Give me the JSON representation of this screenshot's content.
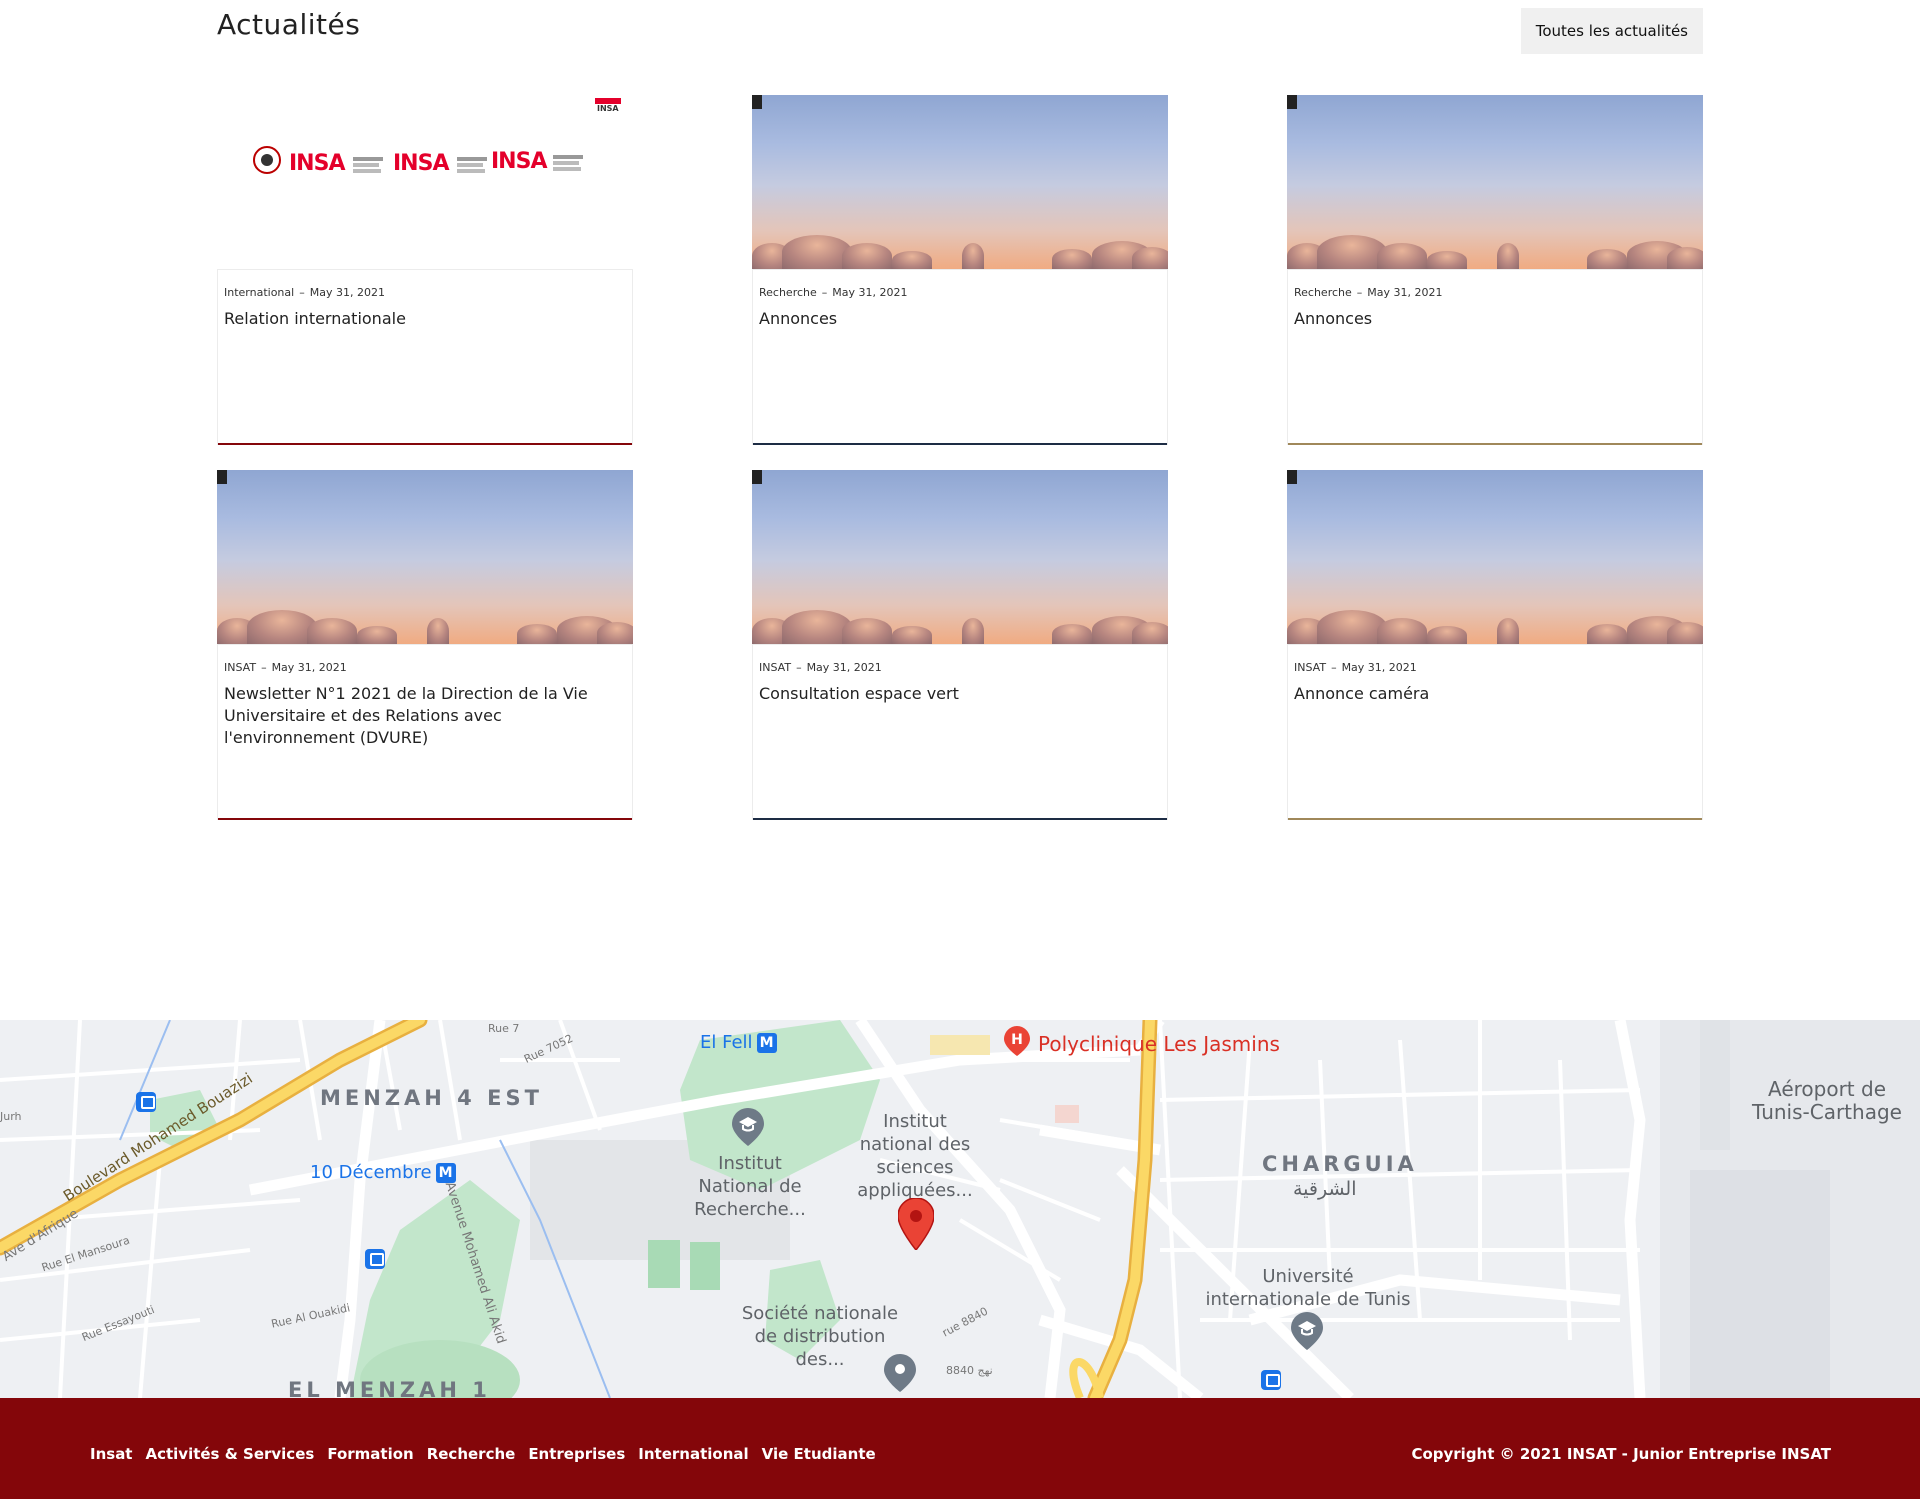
{
  "news": {
    "title": "Actualités",
    "all_news_label": "Toutes les actualités",
    "cards": [
      {
        "category": "International",
        "date": "May 31, 2021",
        "title": "Relation internationale",
        "bar_color": "#84060a",
        "image": "insa-logos"
      },
      {
        "category": "Recherche",
        "date": "May 31, 2021",
        "title": "Annonces",
        "bar_color": "#1d2c44",
        "image": "sunset-sky"
      },
      {
        "category": "Recherche",
        "date": "May 31, 2021",
        "title": "Annonces",
        "bar_color": "#a0885a",
        "image": "sunset-sky"
      },
      {
        "category": "INSAT",
        "date": "May 31, 2021",
        "title": "Newsletter N°1 2021 de la Direction de la Vie Universitaire et des Relations avec l'environnement (DVURE)",
        "bar_color": "#84060a",
        "image": "sunset-sky"
      },
      {
        "category": "INSAT",
        "date": "May 31, 2021",
        "title": "Consultation espace vert",
        "bar_color": "#1d2c44",
        "image": "sunset-sky"
      },
      {
        "category": "INSAT",
        "date": "May 31, 2021",
        "title": "Annonce caméra",
        "bar_color": "#a0885a",
        "image": "sunset-sky"
      }
    ],
    "date_separator": "–"
  },
  "logos": {
    "insa_1": "INSA",
    "insa_2": "INSA",
    "insa_3": "INSA",
    "groupe": "INSA"
  },
  "map": {
    "districts": [
      "MENZAH 4 EST",
      "CHARGUIA",
      "EL MENZAH 1"
    ],
    "charguia_arabic": "الشرقية",
    "places": {
      "insat": "Institut national des sciences appliquées...",
      "recherche": "Institut National de Recherche...",
      "societe": "Société nationale de distribution des...",
      "universite": "Université internationale de Tunis",
      "aeroport": "Aéroport de Tunis-Carthage",
      "polyclinique": "Polyclinique Les Jasmins"
    },
    "metro": {
      "el_fell": "El Fell",
      "dix_decembre": "10 Décembre",
      "badge": "M"
    },
    "roads": {
      "bouazizi": "Boulevard Mohamed Bouazizi",
      "afrique": "Ave d'Afrique",
      "alakid": "Avenue Mohamed Ali Akid",
      "mansoura": "Rue El Mansoura",
      "essayouti": "Rue Essayouti",
      "ouakidi": "Rue Al Ouakidi",
      "rue7052": "Rue 7052",
      "rue8840": "rue 8840",
      "rue8840ar": "8840 نهج",
      "jurh": "Jurh",
      "rue7": "Rue 7"
    },
    "colors": {
      "park": "#c2e6cb",
      "road": "#ffffff",
      "highway": "#f8c94d",
      "marker": "#ea4335"
    }
  },
  "footer": {
    "nav": [
      "Insat",
      "Activités & Services",
      "Formation",
      "Recherche",
      "Entreprises",
      "International",
      "Vie Etudiante"
    ],
    "copyright": "Copyright © 2021 INSAT - Junior Entreprise INSAT",
    "background": "#84060a"
  }
}
